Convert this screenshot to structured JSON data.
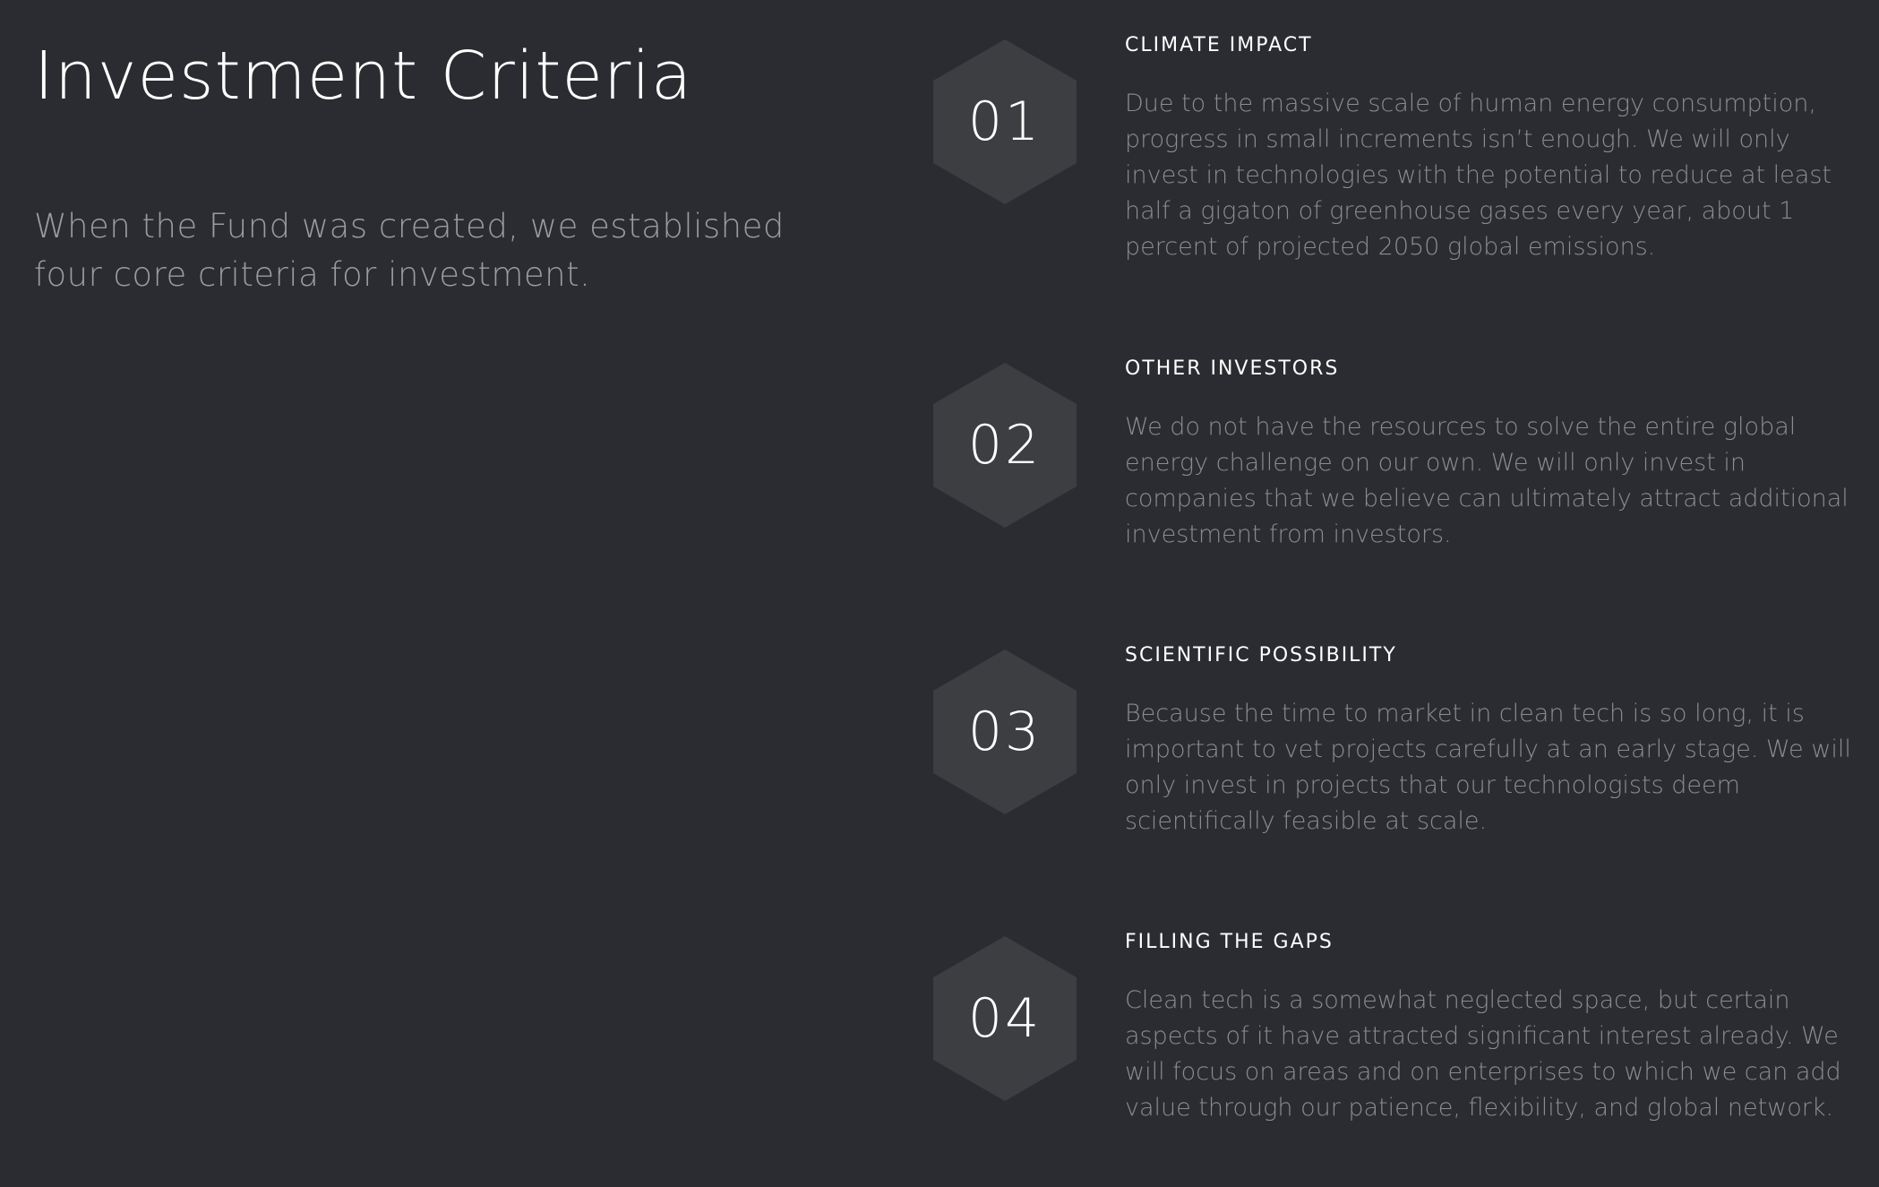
{
  "page": {
    "title": "Investment Criteria",
    "intro": "When the Fund was created, we established four core criteria for investment."
  },
  "criteria": [
    {
      "number": "01",
      "title": "CLIMATE IMPACT",
      "body": "Due to the massive scale of human energy consumption, progress in small increments isn’t enough. We will only invest in technologies with the potential to reduce at least half a gigaton of greenhouse gases every year, about 1 percent of projected 2050 global emissions."
    },
    {
      "number": "02",
      "title": "OTHER INVESTORS",
      "body": "We do not have the resources to solve the entire global energy challenge on our own. We will only invest in companies that we believe can ultimately attract additional investment from investors."
    },
    {
      "number": "03",
      "title": "SCIENTIFIC POSSIBILITY",
      "body": "Because the time to market in clean tech is so long, it is important to vet projects carefully at an early stage. We will only invest in projects that our technologists deem scientifically feasible at scale."
    },
    {
      "number": "04",
      "title": "FILLING THE GAPS",
      "body": "Clean tech is a somewhat neglected space, but certain aspects of it have attracted significant interest already. We will focus on areas and on enterprises to which we can add value through our patience, flexibility, and global network."
    }
  ],
  "colors": {
    "background": "#2b2c31",
    "hexagon": "#3d3e42",
    "heading": "#ffffff",
    "body_text": "#8b8c91"
  }
}
